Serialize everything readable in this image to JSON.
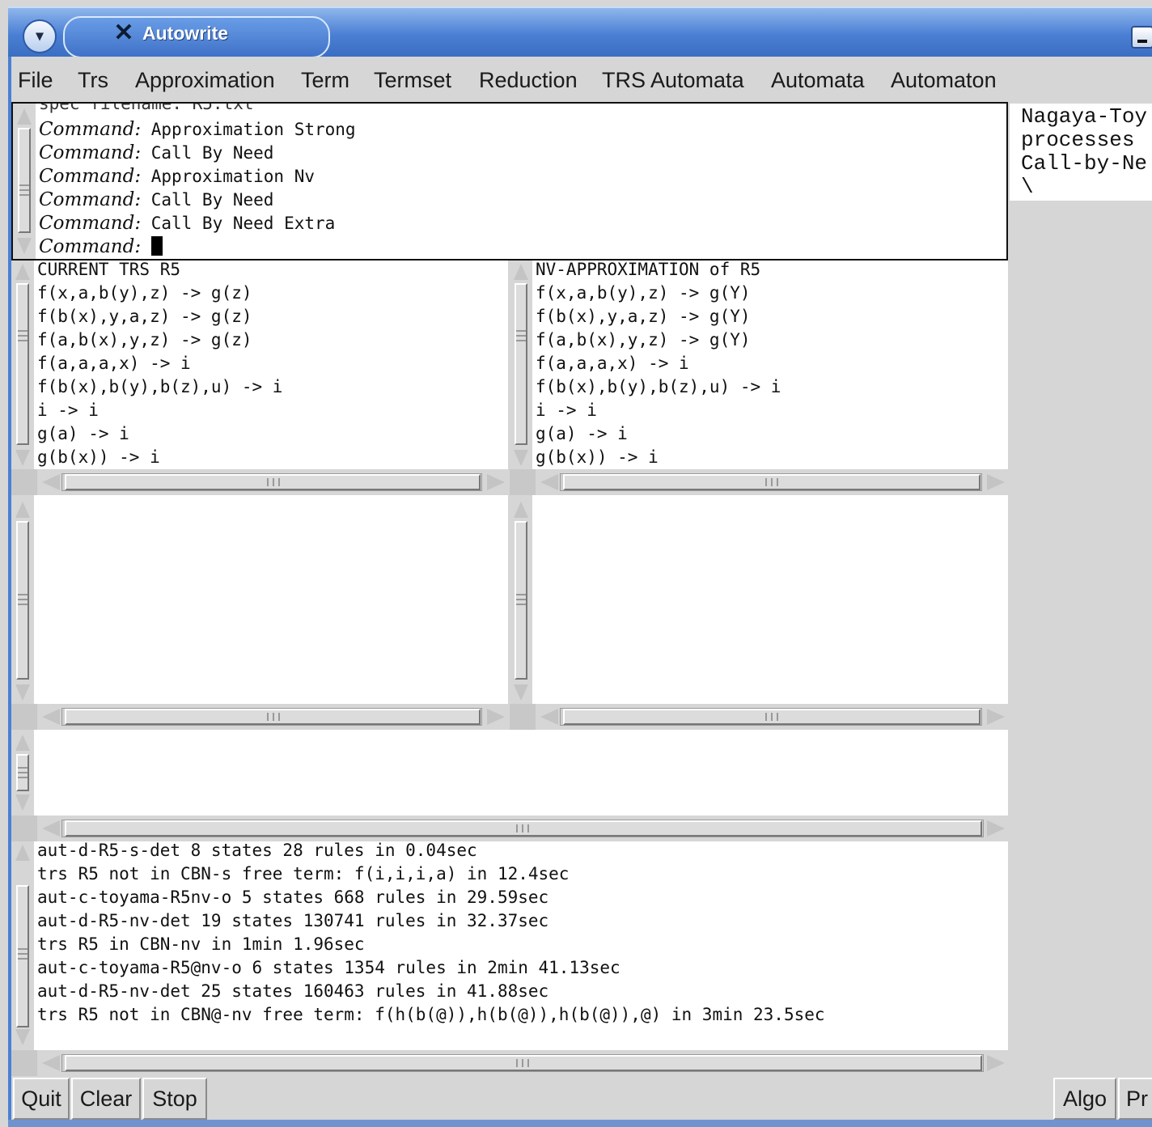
{
  "window": {
    "title": "Autowrite",
    "window_menu_glyph": "▾"
  },
  "menubar": {
    "items": [
      "File",
      "Trs",
      "Approximation",
      "Term",
      "Termset",
      "Reduction",
      "TRS Automata",
      "Automata",
      "Automaton"
    ]
  },
  "command_pane": {
    "partial_top_line": "spec filename: R5.txt",
    "lines": [
      {
        "label": "Command:",
        "text": "Approximation Strong"
      },
      {
        "label": "Command:",
        "text": "Call By Need"
      },
      {
        "label": "Command:",
        "text": "Approximation Nv"
      },
      {
        "label": "Command:",
        "text": "Call By Need"
      },
      {
        "label": "Command:",
        "text": "Call By Need Extra"
      },
      {
        "label": "Command:",
        "text": ""
      }
    ]
  },
  "left_trs_pane": {
    "title": "CURRENT TRS R5",
    "rules": [
      "f(x,a,b(y),z) -> g(z)",
      "f(b(x),y,a,z) -> g(z)",
      "f(a,b(x),y,z) -> g(z)",
      "f(a,a,a,x) -> i",
      "f(b(x),b(y),b(z),u) -> i",
      "i -> i",
      "g(a) -> i",
      "g(b(x)) -> i"
    ]
  },
  "right_trs_pane": {
    "title": "NV-APPROXIMATION of R5",
    "rules": [
      "f(x,a,b(y),z) -> g(Y)",
      "f(b(x),y,a,z) -> g(Y)",
      "f(a,b(x),y,z) -> g(Y)",
      "f(a,a,a,x) -> i",
      "f(b(x),b(y),b(z),u) -> i",
      "i -> i",
      "g(a) -> i",
      "g(b(x)) -> i"
    ]
  },
  "output_pane": {
    "lines": [
      "aut-d-R5-s-det 8 states 28 rules in 0.04sec",
      "trs R5 not in CBN-s free term: f(i,i,i,a) in 12.4sec",
      "aut-c-toyama-R5nv-o 5 states 668 rules in 29.59sec",
      "aut-d-R5-nv-det 19 states 130741 rules in 32.37sec",
      "trs R5 in CBN-nv in 1min 1.96sec",
      "aut-c-toyama-R5@nv-o 6 states 1354 rules in 2min 41.13sec",
      "aut-d-R5-nv-det 25 states 160463 rules in 41.88sec",
      "trs R5 not in CBN@-nv free term: f(h(b(@)),h(b(@)),h(b(@)),@) in 3min 23.5sec"
    ]
  },
  "side_pane": {
    "lines": [
      "Nagaya-Toy",
      "processes",
      "Call-by-Ne",
      "\\"
    ]
  },
  "buttons": {
    "quit": "Quit",
    "clear": "Clear",
    "stop": "Stop",
    "algo": "Algo",
    "pr": "Pr"
  },
  "icons": {
    "window_menu": "chevron-down-icon",
    "app_logo": "x-logo-icon",
    "minimize": "minimize-icon"
  },
  "colors": {
    "titlebar": "#4a7fd4",
    "panel": "#d6d6d6",
    "text": "#111111"
  }
}
